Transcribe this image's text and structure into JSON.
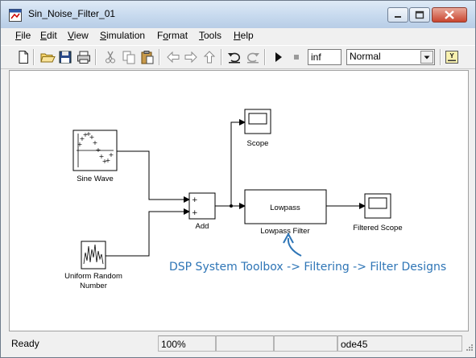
{
  "window": {
    "title": "Sin_Noise_Filter_01"
  },
  "menu": [
    "File",
    "Edit",
    "View",
    "Simulation",
    "Format",
    "Tools",
    "Help"
  ],
  "menu_mnemonic": [
    "F",
    "E",
    "V",
    "S",
    "o",
    "T",
    "H"
  ],
  "toolbar": {
    "stop_time": "inf",
    "sim_mode": "Normal"
  },
  "blocks": {
    "sine": "Sine Wave",
    "uniform_l1": "Uniform Random",
    "uniform_l2": "Number",
    "add": "Add",
    "add_port1": "+",
    "add_port2": "+",
    "scope": "Scope",
    "lowpass_inner": "Lowpass",
    "lowpass": "Lowpass Filter",
    "filtered_scope": "Filtered Scope"
  },
  "annotation": "DSP System Toolbox -> Filtering -> Filter Designs",
  "status": {
    "ready": "Ready",
    "zoom": "100%",
    "solver": "ode45"
  },
  "colors": {
    "annotation": "#2e75b6",
    "title_bar": "#c9dbef"
  },
  "icons": [
    "model-icon",
    "minimize-icon",
    "maximize-icon",
    "close-icon",
    "new-icon",
    "open-icon",
    "save-icon",
    "print-icon",
    "cut-icon",
    "copy-icon",
    "paste-icon",
    "back-icon",
    "forward-icon",
    "up-icon",
    "undo-icon",
    "redo-icon",
    "play-icon",
    "stop-icon",
    "dropdown-arrow-icon",
    "library-icon"
  ]
}
